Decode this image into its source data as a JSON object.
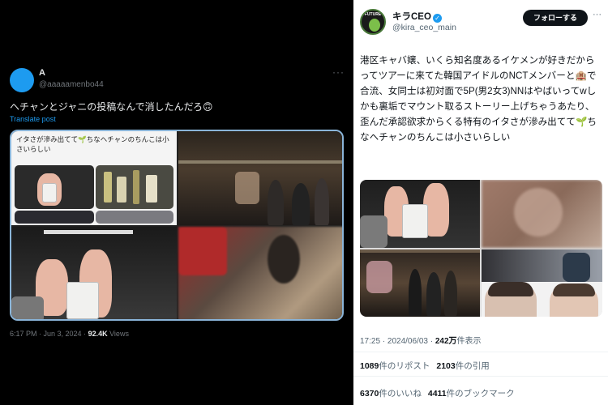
{
  "left_tweet": {
    "author_name": "A",
    "author_handle": "@aaaaamenbo44",
    "more_glyph": "···",
    "text": "ヘチャンとジャニの投稿なんで消したんだろ🙃",
    "translate_label": "Translate post",
    "image_caption": "イタさが滲み出てて🌱ちなヘチャンのちんこは小さいらしい",
    "image_strip_text": "▬▬▬▬▬▬▬▬▬▬▬▬",
    "time": "6:17 PM · Jun 3, 2024 · ",
    "views_count": "92.4K",
    "views_label": " Views"
  },
  "right_tweet": {
    "author_name": "キラCEO",
    "author_handle": "@kira_ceo_main",
    "avatar_text": "FUTURE",
    "verified_glyph": "✓",
    "follow_label": "フォローする",
    "more_glyph": "···",
    "text": "港区キャバ嬢、いくら知名度あるイケメンが好きだからってツアーに来てた韓国アイドルのNCTメンバーと🏨で合流、女同士は初対面で5P(男2女3)NNはやばいってwしかも裏垢でマウント取るストーリー上げちゃうあたり、歪んだ承認欲求からくる特有のイタさが滲み出てて🌱ちなヘチャンのちんこは小さいらしい",
    "time": "17:25 · 2024/06/03 · ",
    "views_count": "242万",
    "views_label": "件表示",
    "reposts_count": "1089",
    "reposts_label": "件のリポスト",
    "quotes_count": "2103",
    "quotes_label": "件の引用",
    "likes_count": "6370",
    "likes_label": "件のいいね",
    "bookmarks_count": "4411",
    "bookmarks_label": "件のブックマーク"
  },
  "colors": {
    "dark_bg": "#000000",
    "light_bg": "#ffffff",
    "accent": "#1d9bf0",
    "secondary_text": "#71767b"
  }
}
